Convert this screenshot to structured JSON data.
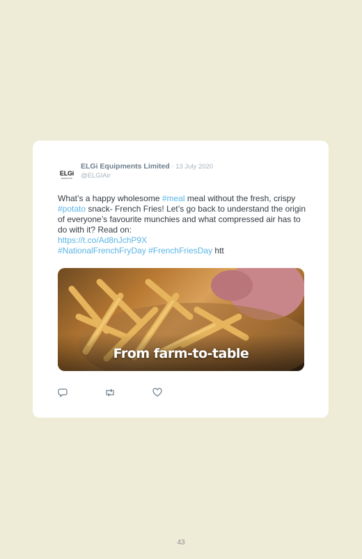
{
  "tweet": {
    "avatar_logo": "ELGi",
    "avatar_sub": "Equipments",
    "author_name": "ELGi Equipments Limited",
    "date": " · 13 July 2020",
    "handle": "@ELGIAir",
    "text_1": "What’s a happy wholesome ",
    "hashtag_meal": "#meal",
    "text_2": " meal without the fresh, crispy ",
    "hashtag_potato": "#potato",
    "text_3": " snack- French Fries! Let’s go back to understand the origin of everyone’s favourite munchies and what compressed air has to do with it? Read on: ",
    "link_url": "https://t.co/Ad8nJchP9X",
    "hashtag_fry_day": "#NationalFrenchFryDay",
    "hashtag_fries_day": "#FrenchFriesDay",
    "text_4": " htt",
    "media_caption": "From farm-to-table"
  },
  "actions": {
    "reply_icon": "reply-icon",
    "retweet_icon": "retweet-icon",
    "like_icon": "heart-icon"
  },
  "page_number": "43",
  "colors": {
    "background": "#eeebd6",
    "card": "#ffffff",
    "link": "#5ab4e5",
    "name": "#6b7d8c"
  }
}
